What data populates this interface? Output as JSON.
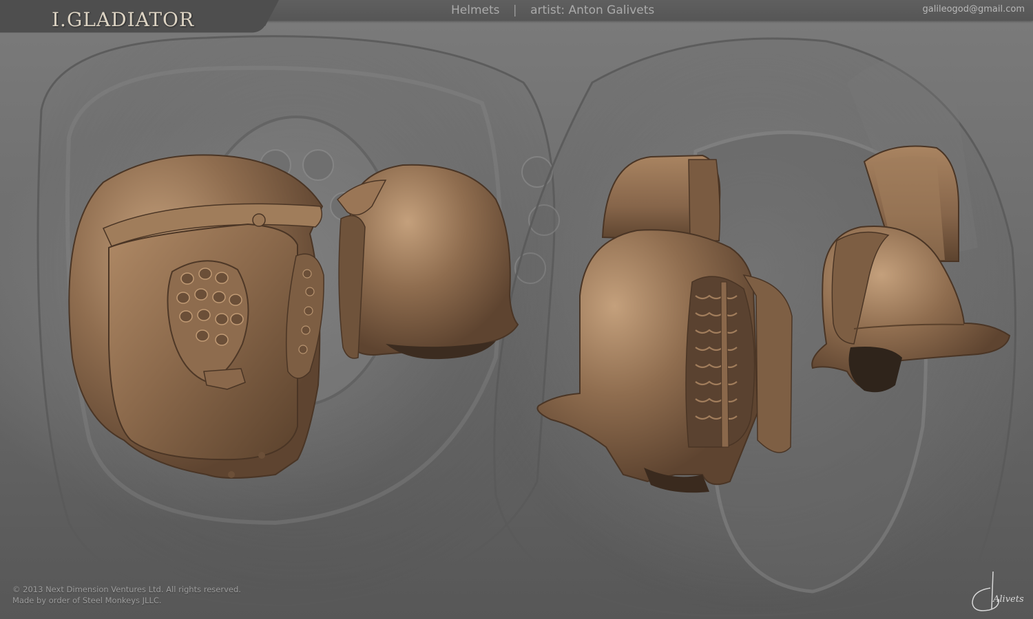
{
  "brand": {
    "title": "I.GLADIATOR"
  },
  "header": {
    "category": "Helmets",
    "separator": "|",
    "artist": "artist: Anton Galivets",
    "email": "galileogod@gmail.com"
  },
  "helmets": [
    {
      "name": "helmet-pierced-visor-3q"
    },
    {
      "name": "helmet-pierced-visor-back"
    },
    {
      "name": "helmet-grated-visor-crest-front"
    },
    {
      "name": "helmet-grated-visor-crest-back"
    }
  ],
  "footer": {
    "copyright": "© 2013 Next Dimension Ventures Ltd. All rights reserved.",
    "order": "Made by order of Steel Monkeys JLLC."
  },
  "signature": {
    "text": "Alivets"
  },
  "colors": {
    "bronze": "#8c6a4c",
    "bronze_light": "#b08a66",
    "bronze_dark": "#5a412c",
    "background": "#6a6a6a",
    "title": "#ddd4c4"
  }
}
